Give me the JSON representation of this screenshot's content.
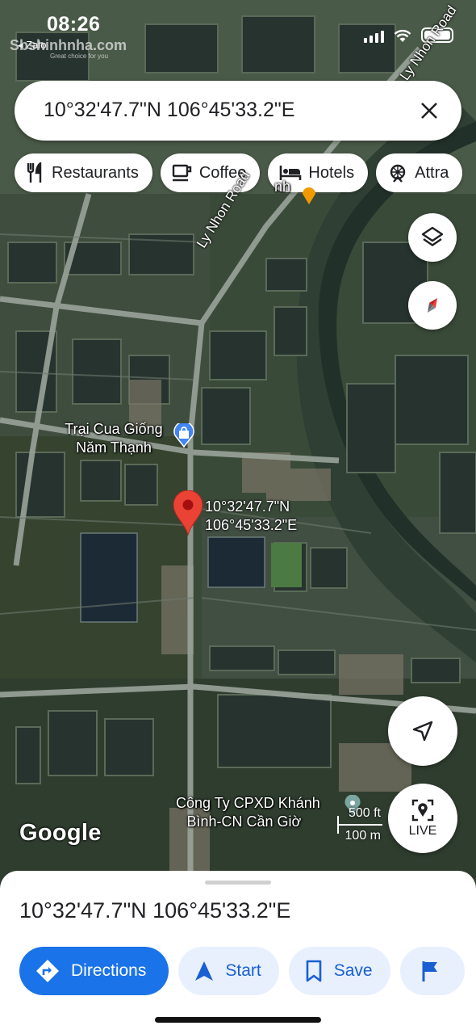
{
  "status_bar": {
    "time": "08:26",
    "back_app": "◂ Zalo",
    "watermark": "Sbshinhnha.com",
    "watermark_sub": "Great choice for you"
  },
  "search": {
    "query": "10°32'47.7\"N 106°45'33.2\"E",
    "close_icon": "close-icon"
  },
  "chips": [
    {
      "label": "Restaurants",
      "icon": "fork-knife-icon"
    },
    {
      "label": "Coffee",
      "icon": "coffee-cup-icon"
    },
    {
      "label": "Hotels",
      "icon": "bed-icon"
    },
    {
      "label": "Attra",
      "icon": "attractions-icon"
    }
  ],
  "map": {
    "road_name_1": "Ly Nhon Road",
    "road_name_2": "Ly Nhon Road",
    "place_1_line1": "Trại Cua Giống",
    "place_1_line2": "Năm Thạnh",
    "place_partial_top": "nh",
    "place_2_line1": "Công Ty CPXD Khánh",
    "place_2_line2": "Bình-CN Cần Giờ",
    "pin_line1": "10°32'47.7\"N",
    "pin_line2": "106°45'33.2\"E",
    "google_logo": "Google",
    "scale_imperial": "500 ft",
    "scale_metric": "100 m",
    "live_label": "LIVE",
    "pin_color": "#ea4335",
    "accent_color": "#1a73e8"
  },
  "sheet": {
    "coords": "10°32'47.7\"N 106°45'33.2\"E",
    "actions": [
      {
        "label": "Directions",
        "icon": "directions-icon"
      },
      {
        "label": "Start",
        "icon": "navigation-arrow-icon"
      },
      {
        "label": "Save",
        "icon": "bookmark-icon"
      },
      {
        "label": "",
        "icon": "flag-icon"
      }
    ]
  }
}
